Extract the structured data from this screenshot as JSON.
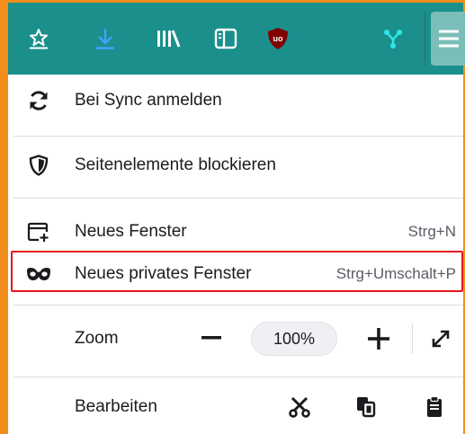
{
  "toolbar": {
    "icons": [
      "bookmarks-star-icon",
      "downloads-icon",
      "library-icon",
      "sidebar-icon",
      "ublock-icon",
      "fork-icon",
      "hamburger-menu-icon"
    ],
    "colors": {
      "background": "#1a8f8b",
      "download_icon": "#45a1ff",
      "ublock": "#800000"
    }
  },
  "menu": {
    "sync_label": "Bei Sync anmelden",
    "block_label": "Seitenelemente blockieren",
    "new_window_label": "Neues Fenster",
    "new_window_shortcut": "Strg+N",
    "private_window_label": "Neues privates Fenster",
    "private_window_shortcut": "Strg+Umschalt+P",
    "zoom_label": "Zoom",
    "zoom_value": "100%",
    "zoom_minus": "−",
    "zoom_plus": "+",
    "edit_label": "Bearbeiten"
  },
  "accent": {
    "highlight": "#e8141c",
    "frame": "#f28e1c"
  }
}
